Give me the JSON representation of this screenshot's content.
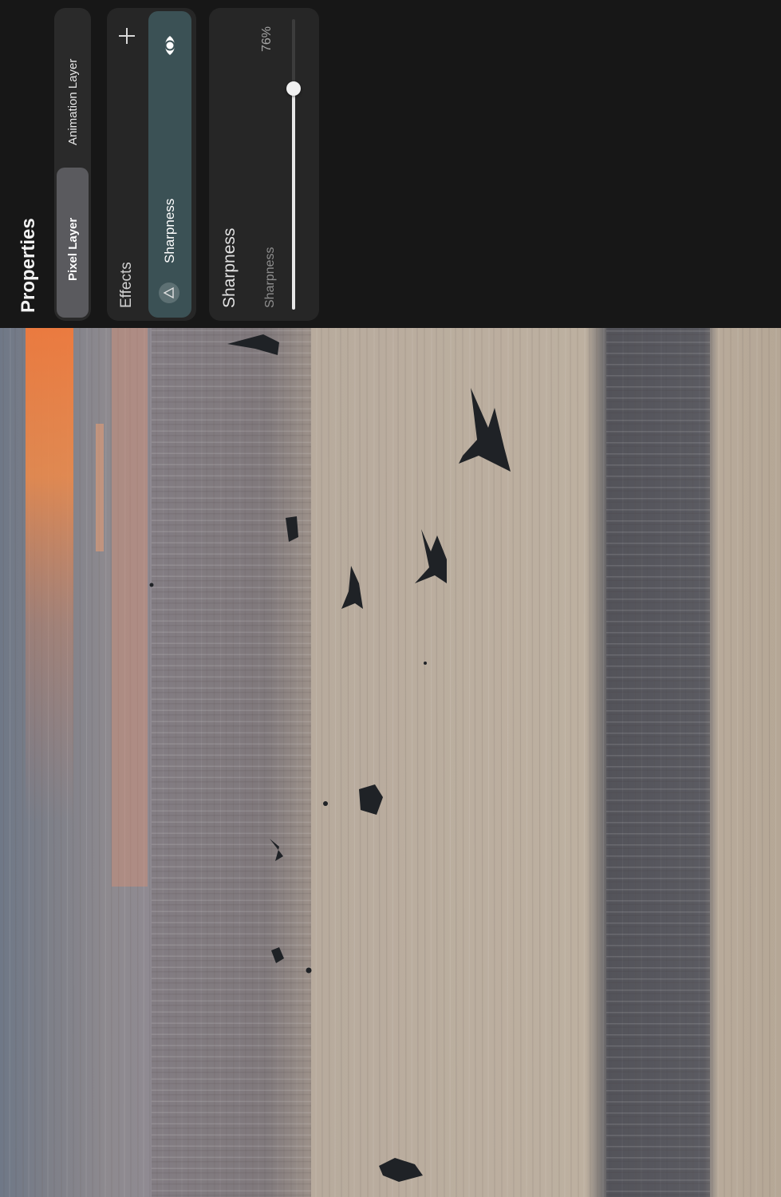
{
  "panel": {
    "title": "Properties",
    "layer_tabs": [
      "Pixel Layer",
      "Animation Layer"
    ],
    "selected_layer_tab": "Pixel Layer"
  },
  "effects": {
    "label": "Effects",
    "items": [
      {
        "label": "Sharpness",
        "icon": "triangle-icon",
        "visibility_icon": "eye-icon"
      }
    ],
    "add_icon": "plus-icon"
  },
  "adjust": {
    "section_title": "Sharpness",
    "slider_label": "Sharpness",
    "value_text": "76%",
    "value": 0.76
  },
  "colors": {
    "panel_bg": "#171717",
    "card_bg": "#262626",
    "selected_effect": "#3b5155",
    "selected_tab": "#5a5a5e"
  }
}
